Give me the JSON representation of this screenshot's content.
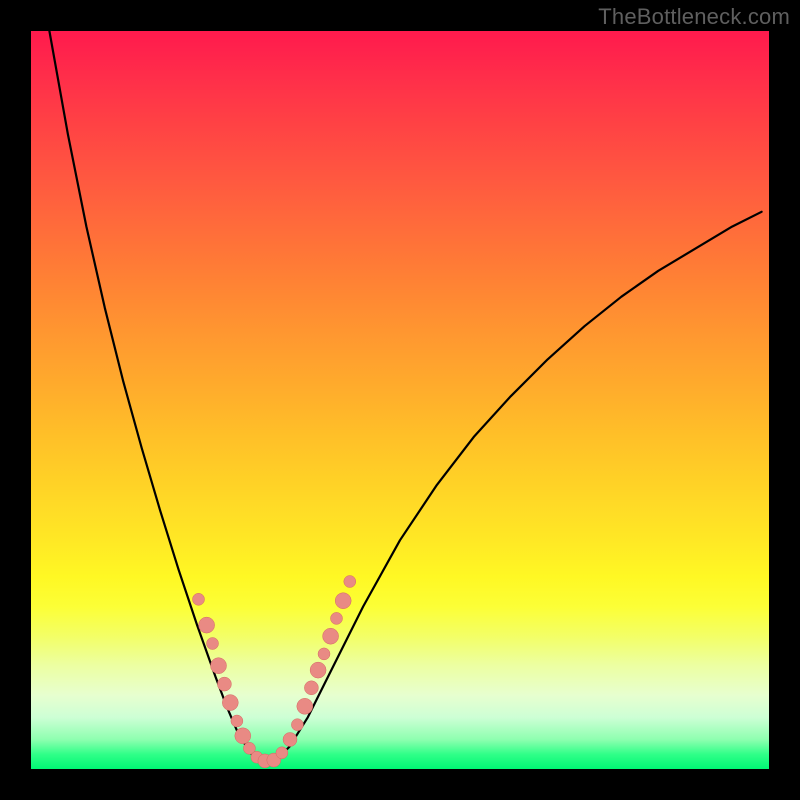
{
  "watermark": {
    "text": "TheBottleneck.com"
  },
  "colors": {
    "curve": "#000000",
    "dot_fill": "#e98a84",
    "dot_stroke": "#d46a63",
    "background_stops": [
      "#ff1a4d",
      "#ff2d4a",
      "#ff4344",
      "#ff5840",
      "#ff6d3a",
      "#ff8234",
      "#ff9730",
      "#ffab2c",
      "#ffc028",
      "#ffd426",
      "#ffe825",
      "#fff824",
      "#fcff36",
      "#f3ff66",
      "#ecffa2",
      "#e7ffcf",
      "#cdffd5",
      "#8effb0",
      "#30ff88",
      "#00f774"
    ]
  },
  "chart_data": {
    "type": "line",
    "title": "",
    "xlabel": "",
    "ylabel": "",
    "xlim": [
      0,
      100
    ],
    "ylim": [
      0,
      100
    ],
    "note": "Axes are implicit (no ticks rendered). x = 0..100 across plot width, y = 0..100 across plot height (0 at bottom). Values estimated from pixel positions.",
    "series": [
      {
        "name": "left-branch",
        "x": [
          2.5,
          5.0,
          7.5,
          10.0,
          12.5,
          15.0,
          17.5,
          20.0,
          22.5,
          25.0,
          26.5,
          28.0,
          29.5,
          30.7
        ],
        "y": [
          100.0,
          86.0,
          73.5,
          62.5,
          52.5,
          43.5,
          35.0,
          27.0,
          19.5,
          12.5,
          8.5,
          5.0,
          2.5,
          1.0
        ]
      },
      {
        "name": "right-branch",
        "x": [
          33.0,
          35.0,
          37.5,
          40.0,
          45.0,
          50.0,
          55.0,
          60.0,
          65.0,
          70.0,
          75.0,
          80.0,
          85.0,
          90.0,
          95.0,
          99.0
        ],
        "y": [
          1.0,
          3.0,
          7.0,
          12.0,
          22.0,
          31.0,
          38.5,
          45.0,
          50.5,
          55.5,
          60.0,
          64.0,
          67.5,
          70.5,
          73.5,
          75.5
        ]
      }
    ],
    "scatter_overlay": {
      "name": "highlight-dots",
      "points": [
        {
          "x": 22.7,
          "y": 23.0
        },
        {
          "x": 23.8,
          "y": 19.5
        },
        {
          "x": 24.6,
          "y": 17.0
        },
        {
          "x": 25.4,
          "y": 14.0
        },
        {
          "x": 26.2,
          "y": 11.5
        },
        {
          "x": 27.0,
          "y": 9.0
        },
        {
          "x": 27.9,
          "y": 6.5
        },
        {
          "x": 28.7,
          "y": 4.5
        },
        {
          "x": 29.6,
          "y": 2.8
        },
        {
          "x": 30.6,
          "y": 1.6
        },
        {
          "x": 31.7,
          "y": 1.1
        },
        {
          "x": 32.9,
          "y": 1.2
        },
        {
          "x": 34.0,
          "y": 2.2
        },
        {
          "x": 35.1,
          "y": 4.0
        },
        {
          "x": 36.1,
          "y": 6.0
        },
        {
          "x": 37.1,
          "y": 8.5
        },
        {
          "x": 38.0,
          "y": 11.0
        },
        {
          "x": 38.9,
          "y": 13.4
        },
        {
          "x": 39.7,
          "y": 15.6
        },
        {
          "x": 40.6,
          "y": 18.0
        },
        {
          "x": 41.4,
          "y": 20.4
        },
        {
          "x": 42.3,
          "y": 22.8
        },
        {
          "x": 43.2,
          "y": 25.4
        }
      ],
      "radii": [
        6,
        8,
        6,
        8,
        7,
        8,
        6,
        8,
        6,
        6,
        7,
        7,
        6,
        7,
        6,
        8,
        7,
        8,
        6,
        8,
        6,
        8,
        6
      ]
    }
  }
}
